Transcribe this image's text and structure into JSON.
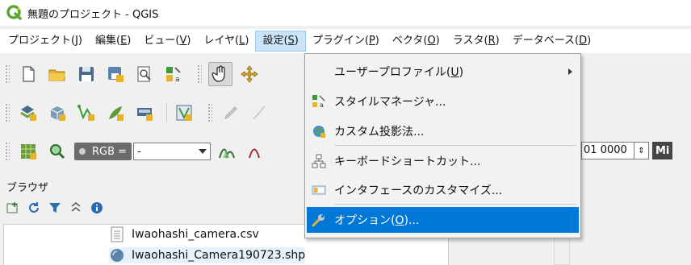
{
  "window": {
    "title": "無題のプロジェクト - QGIS",
    "logo_color": "#5aa832"
  },
  "menubar": {
    "items": [
      {
        "text": "プロジェクト(",
        "key": "J",
        "tail": ")"
      },
      {
        "text": "編集(",
        "key": "E",
        "tail": ")"
      },
      {
        "text": "ビュー(",
        "key": "V",
        "tail": ")"
      },
      {
        "text": "レイヤ(",
        "key": "L",
        "tail": ")"
      },
      {
        "text": "設定(",
        "key": "S",
        "tail": ")"
      },
      {
        "text": "プラグイン(",
        "key": "P",
        "tail": ")"
      },
      {
        "text": "ベクタ(",
        "key": "O",
        "tail": ")"
      },
      {
        "text": "ラスタ(",
        "key": "R",
        "tail": ")"
      },
      {
        "text": "データベース(",
        "key": "D",
        "tail": ")"
      }
    ]
  },
  "settings_menu": {
    "items": [
      {
        "label": "ユーザープロファイル(",
        "key": "U",
        "tail": ")",
        "icon": "none",
        "submenu": true
      },
      {
        "label": "スタイルマネージャ...",
        "icon": "style-manager-icon"
      },
      {
        "label": "カスタム投影法...",
        "icon": "globe-projection-icon"
      },
      {
        "label": "キーボードショートカット...",
        "icon": "keyboard-shortcut-icon"
      },
      {
        "label": "インタフェースのカスタマイズ...",
        "icon": "customize-interface-icon"
      },
      {
        "label": "オプション(",
        "key": "O",
        "tail": ")...",
        "icon": "wrench-icon",
        "highlighted": true
      }
    ],
    "highlight_color": "#0078d7"
  },
  "toolbar3": {
    "rgb_label": "RGB =",
    "combo_value": "-",
    "scale_value": "01 0000",
    "mi_label": "Mi"
  },
  "browser": {
    "title": "ブラウザ",
    "files": [
      {
        "name": "Iwaohashi_camera.csv",
        "icon": "csv-file-icon"
      },
      {
        "name": "Iwaohashi_Camera190723.shp",
        "icon": "shapefile-icon"
      }
    ]
  }
}
